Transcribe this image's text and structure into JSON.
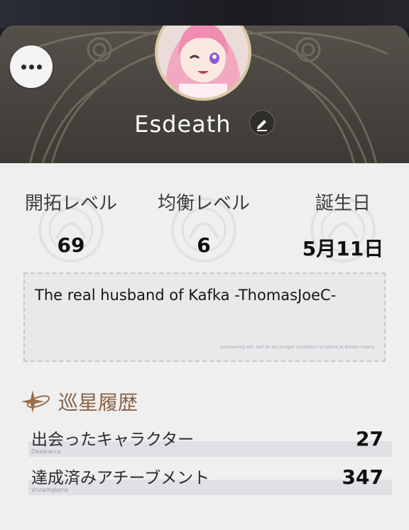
{
  "profile": {
    "username": "Esdeath",
    "bio": "The real husband of Kafka -ThomasJoeC-",
    "bio_decoration": "erasowning elit, sed do eiu tempor incididunt ut labore et dolore magna"
  },
  "stats": [
    {
      "label": "開拓レベル",
      "value": "69"
    },
    {
      "label": "均衡レベル",
      "value": "6"
    },
    {
      "label": "誕生日",
      "value": "5月11日"
    }
  ],
  "history": {
    "title": "巡星履歴",
    "rows": [
      {
        "label": "出会ったキャラクター",
        "sub": "Dexaracra",
        "value": "27"
      },
      {
        "label": "達成済みアチーブメント",
        "sub": "Vnzarhgkena",
        "value": "347"
      }
    ]
  },
  "colors": {
    "banner": "#4c4843",
    "card": "#efeff0",
    "accent_gold": "#c4a576",
    "history_title": "#8a6344"
  },
  "icons": {
    "more": "more-icon",
    "edit": "edit-icon",
    "star": "sparkle-star-icon"
  }
}
